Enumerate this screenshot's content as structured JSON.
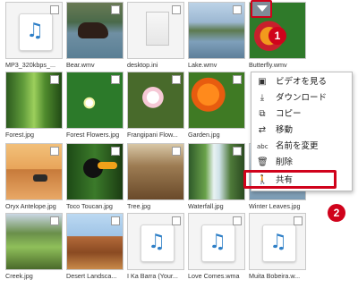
{
  "files": [
    {
      "name": "MP3_320kbps_...",
      "kind": "audio-file"
    },
    {
      "name": "Bear.wmv",
      "kind": "video"
    },
    {
      "name": "desktop.ini",
      "kind": "document"
    },
    {
      "name": "Lake.wmv",
      "kind": "video"
    },
    {
      "name": "Butterfly.wmv",
      "kind": "video"
    },
    {
      "name": "Forest.jpg",
      "kind": "image"
    },
    {
      "name": "Forest Flowers.jpg",
      "kind": "image"
    },
    {
      "name": "Frangipani Flow...",
      "kind": "image"
    },
    {
      "name": "Garden.jpg",
      "kind": "image"
    },
    {
      "name": "Oryx Antelope.jpg",
      "kind": "image"
    },
    {
      "name": "Toco Toucan.jpg",
      "kind": "image"
    },
    {
      "name": "Tree.jpg",
      "kind": "image"
    },
    {
      "name": "Waterfall.jpg",
      "kind": "image"
    },
    {
      "name": "Winter Leaves.jpg",
      "kind": "image"
    },
    {
      "name": "Creek.jpg",
      "kind": "image"
    },
    {
      "name": "Desert Landsca...",
      "kind": "image"
    },
    {
      "name": "I Ka Barra (Your...",
      "kind": "audio-file"
    },
    {
      "name": "Love Comes.wma",
      "kind": "audio-file"
    },
    {
      "name": "Muita Bobeira.w...",
      "kind": "audio-file"
    }
  ],
  "context_menu": {
    "items": [
      {
        "label": "ビデオを見る",
        "icon": "play-video-icon",
        "glyph": "▣"
      },
      {
        "label": "ダウンロード",
        "icon": "download-icon",
        "glyph": "⤓"
      },
      {
        "label": "コピー",
        "icon": "copy-icon",
        "glyph": "⧉"
      },
      {
        "label": "移動",
        "icon": "move-icon",
        "glyph": "⇄"
      },
      {
        "label": "名前を変更",
        "icon": "rename-icon",
        "glyph": "abc"
      },
      {
        "label": "削除",
        "icon": "trash-icon",
        "glyph": "🗑"
      },
      {
        "label": "共有",
        "icon": "share-person-icon",
        "glyph": "🚶"
      }
    ]
  },
  "annotations": {
    "step1": "1",
    "step2": "2"
  },
  "colors": {
    "highlight": "#d0021b",
    "note_icon": "#2e7fc7"
  },
  "glyphs": {
    "music_note": "♫"
  }
}
